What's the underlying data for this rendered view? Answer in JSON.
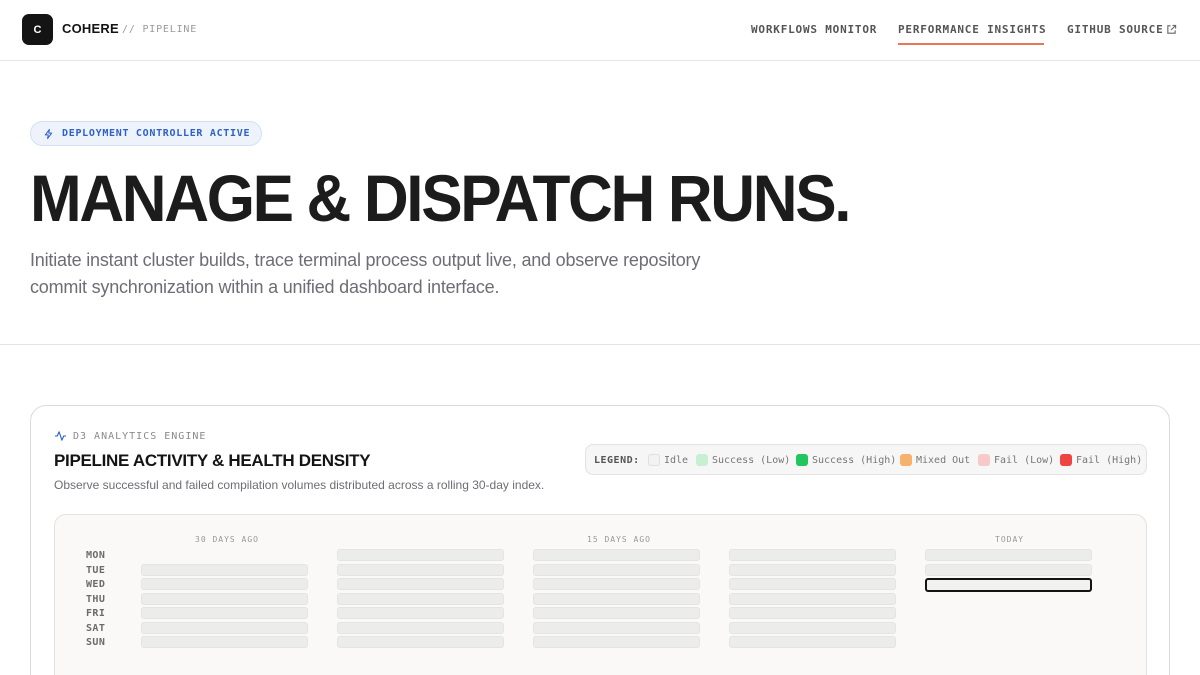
{
  "header": {
    "logo_letter": "C",
    "brand": "COHERE",
    "brand_sub": "// PIPELINE",
    "nav": [
      {
        "label": "WORKFLOWS MONITOR",
        "active": false
      },
      {
        "label": "PERFORMANCE INSIGHTS",
        "active": true
      },
      {
        "label": "GITHUB SOURCE",
        "active": false,
        "icon": "external-link-icon"
      }
    ]
  },
  "hero": {
    "badge": "DEPLOYMENT CONTROLLER ACTIVE",
    "badge_icon": "bolt-icon",
    "title": "MANAGE & DISPATCH RUNS.",
    "subtitle_line1": "Initiate instant cluster builds, trace terminal process output live, and observe repository",
    "subtitle_line2": "commit synchronization within a unified dashboard interface."
  },
  "card": {
    "eyebrow_icon": "activity-icon",
    "eyebrow": "D3 ANALYTICS ENGINE",
    "title": "PIPELINE ACTIVITY & HEALTH DENSITY",
    "subtitle": "Observe successful and failed compilation volumes distributed across a rolling 30-day index.",
    "legend": {
      "label": "LEGEND:",
      "items": [
        {
          "label": "Idle",
          "color": "#f2f2f2"
        },
        {
          "label": "Success (Low)",
          "color": "#c7f0d2"
        },
        {
          "label": "Success (High)",
          "color": "#22c55e"
        },
        {
          "label": "Mixed Out",
          "color": "#f6b26b"
        },
        {
          "label": "Fail (Low)",
          "color": "#f8c9c9"
        },
        {
          "label": "Fail (High)",
          "color": "#ef4444"
        }
      ]
    },
    "heatmap": {
      "period_labels": [
        "30 DAYS AGO",
        "15 DAYS AGO",
        "TODAY"
      ],
      "days": [
        "MON",
        "TUE",
        "WED",
        "THU",
        "FRI",
        "SAT",
        "SUN"
      ],
      "selected": {
        "week": 5,
        "day": "WED"
      }
    }
  }
}
